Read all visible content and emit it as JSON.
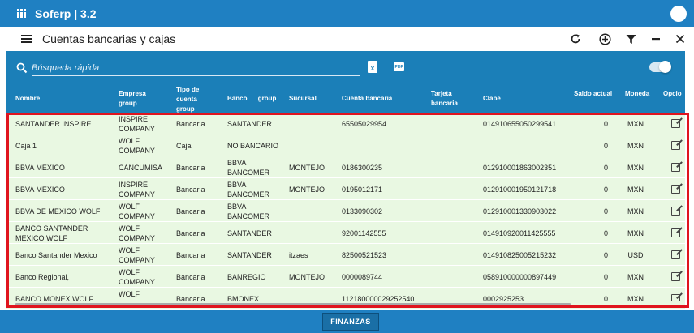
{
  "appbar": {
    "title": "Soferp | 3.2"
  },
  "subbar": {
    "title": "Cuentas bancarias y cajas"
  },
  "search": {
    "placeholder": "Búsqueda rápida"
  },
  "export": {
    "excel_label": "X",
    "pdf_label": "PDF"
  },
  "table": {
    "headers": {
      "nombre": "Nombre",
      "empresa": "Empresa group",
      "tipo": "Tipo de cuenta group",
      "banco": "Banco      group",
      "sucursal": "Sucursal",
      "cuenta": "Cuenta bancaria",
      "tarjeta": "Tarjeta bancaria",
      "clabe": "Clabe",
      "saldo": "Saldo actual",
      "moneda": "Moneda",
      "opciones": "Opcio"
    },
    "rows": [
      {
        "nombre": "SANTANDER INSPIRE",
        "empresa": "INSPIRE COMPANY",
        "tipo": "Bancaria",
        "banco": "SANTANDER",
        "sucursal": "",
        "cuenta": "65505029954",
        "tarjeta": "",
        "clabe": "014910655050299541",
        "saldo": "0",
        "moneda": "MXN"
      },
      {
        "nombre": "Caja 1",
        "empresa": "WOLF COMPANY",
        "tipo": "Caja",
        "banco": "NO BANCARIO",
        "sucursal": "",
        "cuenta": "",
        "tarjeta": "",
        "clabe": "",
        "saldo": "0",
        "moneda": "MXN"
      },
      {
        "nombre": "BBVA MEXICO",
        "empresa": "CANCUMISA",
        "tipo": "Bancaria",
        "banco": "BBVA BANCOMER",
        "sucursal": "MONTEJO",
        "cuenta": "0186300235",
        "tarjeta": "",
        "clabe": "012910001863002351",
        "saldo": "0",
        "moneda": "MXN"
      },
      {
        "nombre": "BBVA MEXICO",
        "empresa": "INSPIRE COMPANY",
        "tipo": "Bancaria",
        "banco": "BBVA BANCOMER",
        "sucursal": "MONTEJO",
        "cuenta": "0195012171",
        "tarjeta": "",
        "clabe": "012910001950121718",
        "saldo": "0",
        "moneda": "MXN"
      },
      {
        "nombre": "BBVA DE MEXICO WOLF",
        "empresa": "WOLF COMPANY",
        "tipo": "Bancaria",
        "banco": "BBVA BANCOMER",
        "sucursal": "",
        "cuenta": "0133090302",
        "tarjeta": "",
        "clabe": "012910001330903022",
        "saldo": "0",
        "moneda": "MXN"
      },
      {
        "nombre": "BANCO SANTANDER MEXICO WOLF",
        "empresa": "WOLF COMPANY",
        "tipo": "Bancaria",
        "banco": "SANTANDER",
        "sucursal": "",
        "cuenta": "92001142555",
        "tarjeta": "",
        "clabe": "014910920011425555",
        "saldo": "0",
        "moneda": "MXN"
      },
      {
        "nombre": "Banco Santander Mexico",
        "empresa": "WOLF COMPANY",
        "tipo": "Bancaria",
        "banco": "SANTANDER",
        "sucursal": "itzaes",
        "cuenta": "82500521523",
        "tarjeta": "",
        "clabe": "014910825005215232",
        "saldo": "0",
        "moneda": "USD"
      },
      {
        "nombre": "Banco Regional,",
        "empresa": "WOLF COMPANY",
        "tipo": "Bancaria",
        "banco": "BANREGIO",
        "sucursal": "MONTEJO",
        "cuenta": "0000089744",
        "tarjeta": "",
        "clabe": "058910000000897449",
        "saldo": "0",
        "moneda": "MXN"
      },
      {
        "nombre": "BANCO MONEX WOLF",
        "empresa": "WOLF COMPANY",
        "tipo": "Bancaria",
        "banco": "BMONEX",
        "sucursal": "",
        "cuenta": "112180000029252540",
        "tarjeta": "",
        "clabe": "0002925253",
        "saldo": "0",
        "moneda": "MXN"
      }
    ]
  },
  "footer": {
    "button_label": "FINANZAS"
  },
  "colors": {
    "primary": "#1f80c2",
    "panel": "#1b7fb8",
    "row_bg": "#e9f8e2",
    "highlight": "#e0141e"
  }
}
